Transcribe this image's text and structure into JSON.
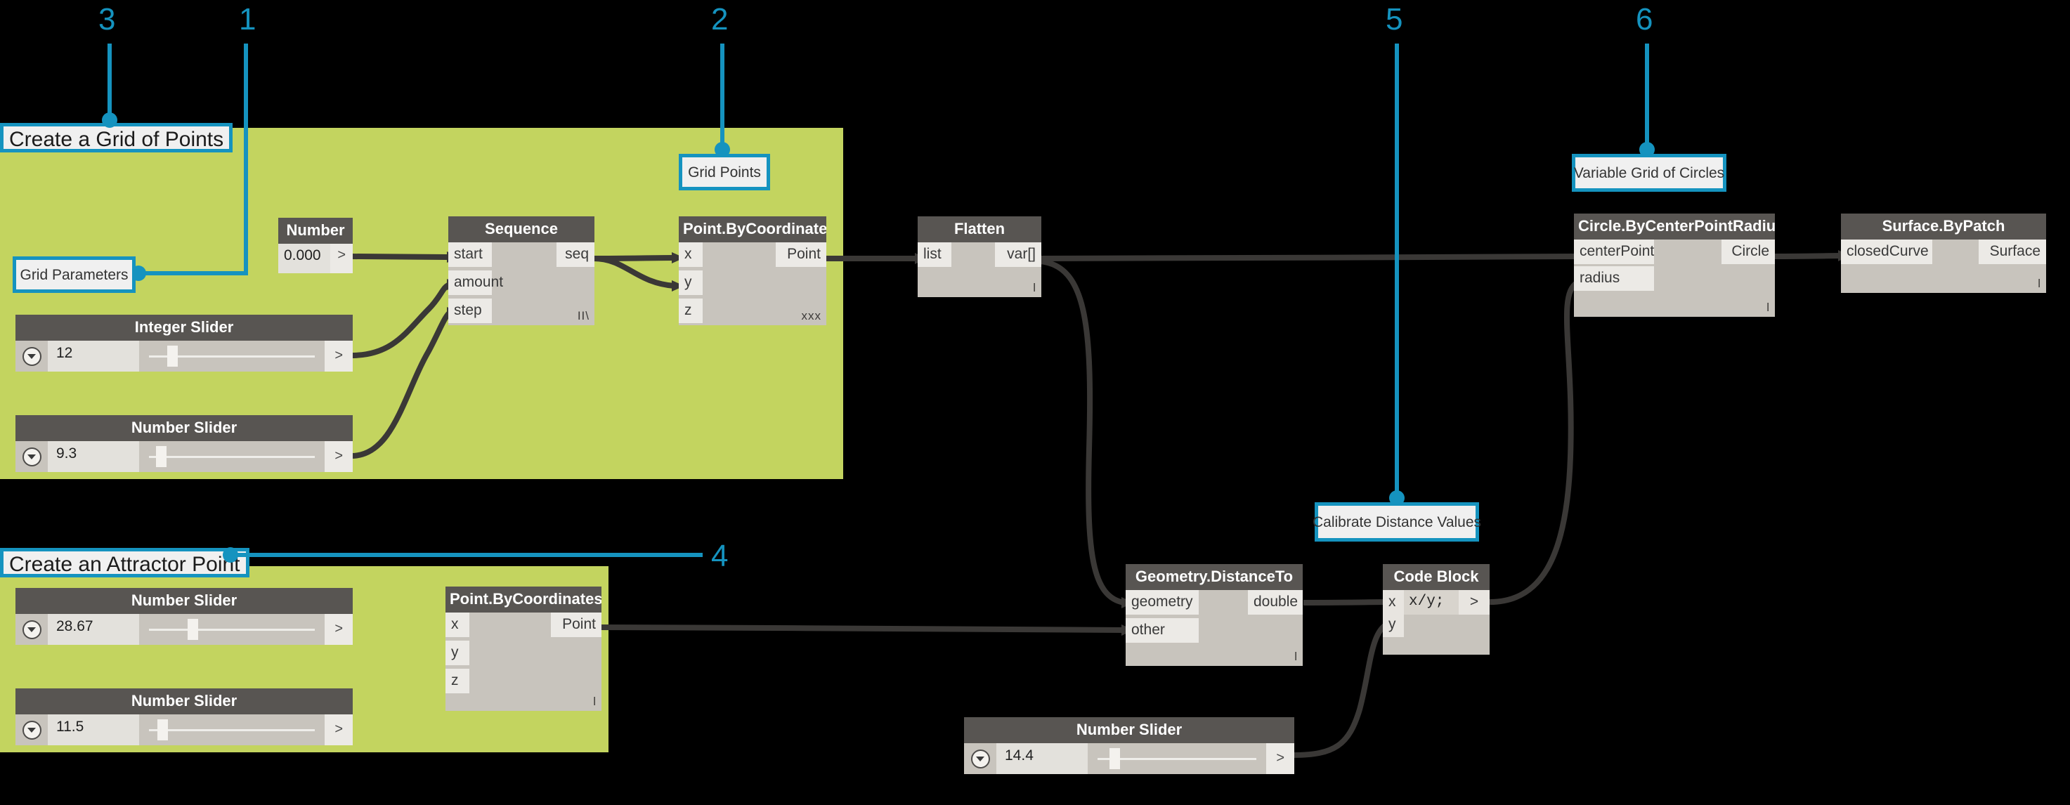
{
  "canvas": {
    "background": "#000000",
    "group_color": "#c3d45f",
    "accent": "#1593bf",
    "node_header": "#585552",
    "node_body": "#c8c4bd",
    "wire": "#3a3836"
  },
  "groups": [
    {
      "title": "Create a Grid of Points"
    },
    {
      "title": "Create an Attractor Point"
    }
  ],
  "annotations": [
    {
      "number": "1"
    },
    {
      "number": "2"
    },
    {
      "number": "3"
    },
    {
      "number": "4"
    },
    {
      "number": "5"
    },
    {
      "number": "6"
    }
  ],
  "callouts": [
    {
      "label": "Grid Parameters"
    },
    {
      "label": "Grid Points"
    },
    {
      "label": "Calibrate Distance Values"
    },
    {
      "label": "Variable Grid of Circles"
    }
  ],
  "nodes": {
    "number": {
      "title": "Number",
      "value": "0.000",
      "caret": ">"
    },
    "integer_slider": {
      "title": "Integer Slider",
      "value": "12",
      "caret": ">",
      "knob_pct": 15
    },
    "number_slider_grid": {
      "title": "Number Slider",
      "value": "9.3",
      "caret": ">",
      "knob_pct": 9
    },
    "sequence": {
      "title": "Sequence",
      "inputs": [
        "start",
        "amount",
        "step"
      ],
      "outputs": [
        "seq"
      ],
      "lacing": "II\\"
    },
    "point_by_coordinates_grid": {
      "title": "Point.ByCoordinates",
      "inputs": [
        "x",
        "y",
        "z"
      ],
      "outputs": [
        "Point"
      ],
      "lacing": "xxx"
    },
    "flatten": {
      "title": "Flatten",
      "inputs": [
        "list"
      ],
      "outputs": [
        "var[]"
      ],
      "lacing": "l"
    },
    "number_slider_attr_x": {
      "title": "Number Slider",
      "value": "28.67",
      "caret": ">",
      "knob_pct": 26
    },
    "number_slider_attr_y": {
      "title": "Number Slider",
      "value": "11.5",
      "caret": ">",
      "knob_pct": 10
    },
    "point_by_coordinates_attr": {
      "title": "Point.ByCoordinates",
      "inputs": [
        "x",
        "y",
        "z"
      ],
      "outputs": [
        "Point"
      ],
      "lacing": "l"
    },
    "geometry_distanceto": {
      "title": "Geometry.DistanceTo",
      "inputs": [
        "geometry",
        "other"
      ],
      "outputs": [
        "double"
      ],
      "lacing": "l"
    },
    "code_block": {
      "title": "Code Block",
      "inputs": [
        "x",
        "y"
      ],
      "code": "x/y;",
      "caret": ">"
    },
    "number_slider_divisor": {
      "title": "Number Slider",
      "value": "14.4",
      "caret": ">",
      "knob_pct": 12
    },
    "circle_by_center_point_radius": {
      "title": "Circle.ByCenterPointRadius",
      "inputs": [
        "centerPoint",
        "radius"
      ],
      "outputs": [
        "Circle"
      ],
      "lacing": "l"
    },
    "surface_by_patch": {
      "title": "Surface.ByPatch",
      "inputs": [
        "closedCurve"
      ],
      "outputs": [
        "Surface"
      ],
      "lacing": "l"
    }
  }
}
